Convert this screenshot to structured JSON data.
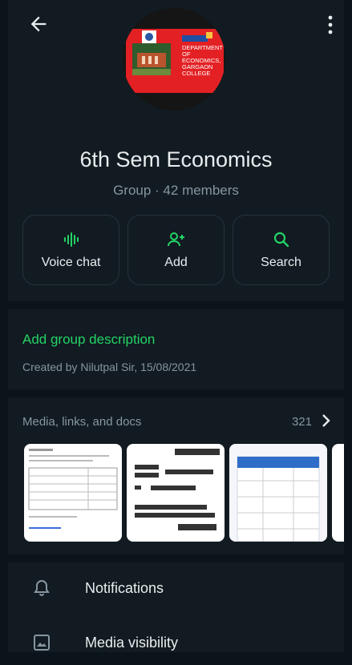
{
  "header": {
    "group_name": "6th Sem Economics",
    "group_info": "Group · 42 members",
    "avatar_text": [
      "DEPARTMENT",
      "OF",
      "ECONOMICS,",
      "GARGAON",
      "COLLEGE"
    ]
  },
  "actions": [
    {
      "label": "Voice chat",
      "icon": "voice-chat-icon"
    },
    {
      "label": "Add",
      "icon": "add-person-icon"
    },
    {
      "label": "Search",
      "icon": "search-icon"
    }
  ],
  "description": {
    "add_label": "Add group description",
    "created_text": "Created by Nilutpal Sir, 15/08/2021"
  },
  "media": {
    "title": "Media, links, and docs",
    "count": "321"
  },
  "settings": [
    {
      "label": "Notifications",
      "icon": "bell-icon"
    },
    {
      "label": "Media visibility",
      "icon": "image-icon"
    }
  ],
  "colors": {
    "accent": "#25d366",
    "background": "#0b141a",
    "panel": "#111b21"
  }
}
